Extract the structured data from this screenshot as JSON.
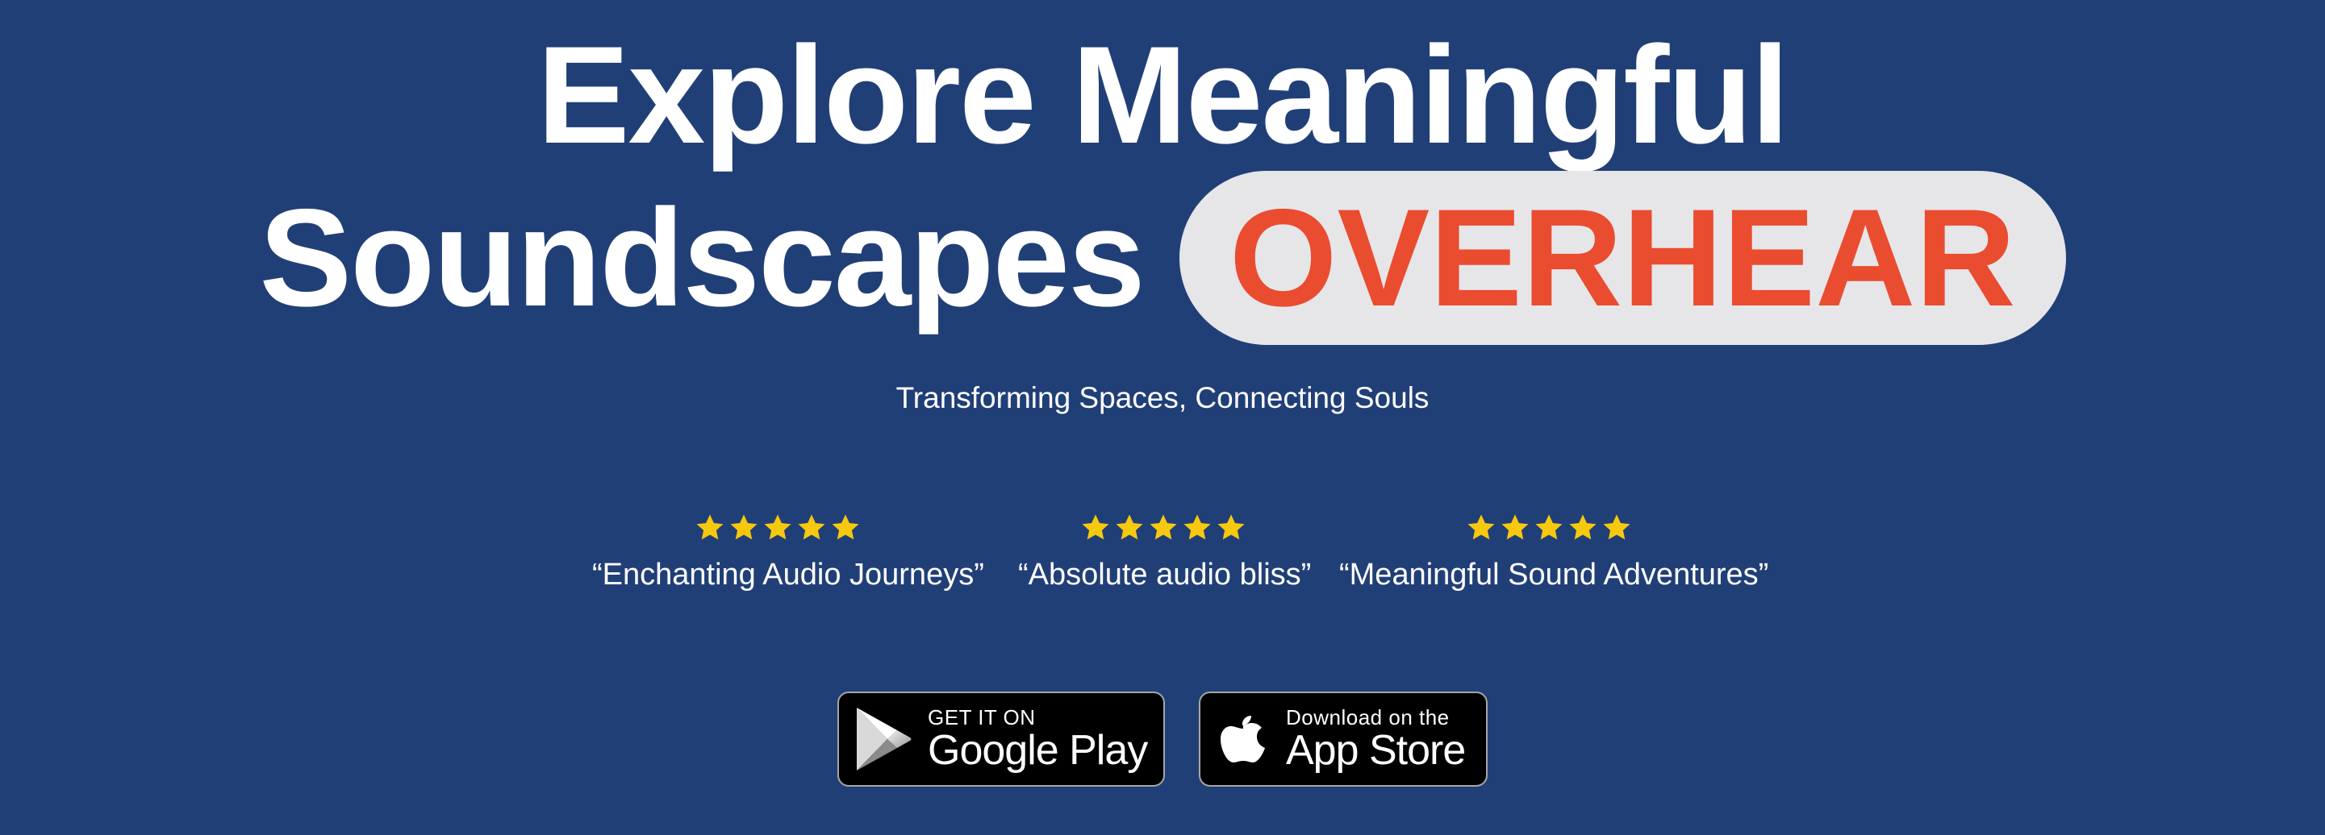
{
  "headline": {
    "line1": "Explore Meaningful",
    "line2": "Soundscapes",
    "brand": "OVERHEAR"
  },
  "tagline": "Transforming Spaces, Connecting Souls",
  "reviews": [
    {
      "rating": 5,
      "quote": "“Enchanting Audio Journeys”"
    },
    {
      "rating": 5,
      "quote": "“Absolute audio bliss”"
    },
    {
      "rating": 5,
      "quote": "“Meaningful Sound Adventures”"
    }
  ],
  "stores": {
    "google": {
      "small": "GET IT ON",
      "big": "Google Play",
      "icon": "google-play-icon"
    },
    "apple": {
      "small": "Download on the",
      "big": "App Store",
      "icon": "apple-icon"
    }
  },
  "colors": {
    "background": "#213f77",
    "brand_red": "#ea4c30",
    "pill": "#e6e6e9",
    "star": "#f6c90e"
  }
}
